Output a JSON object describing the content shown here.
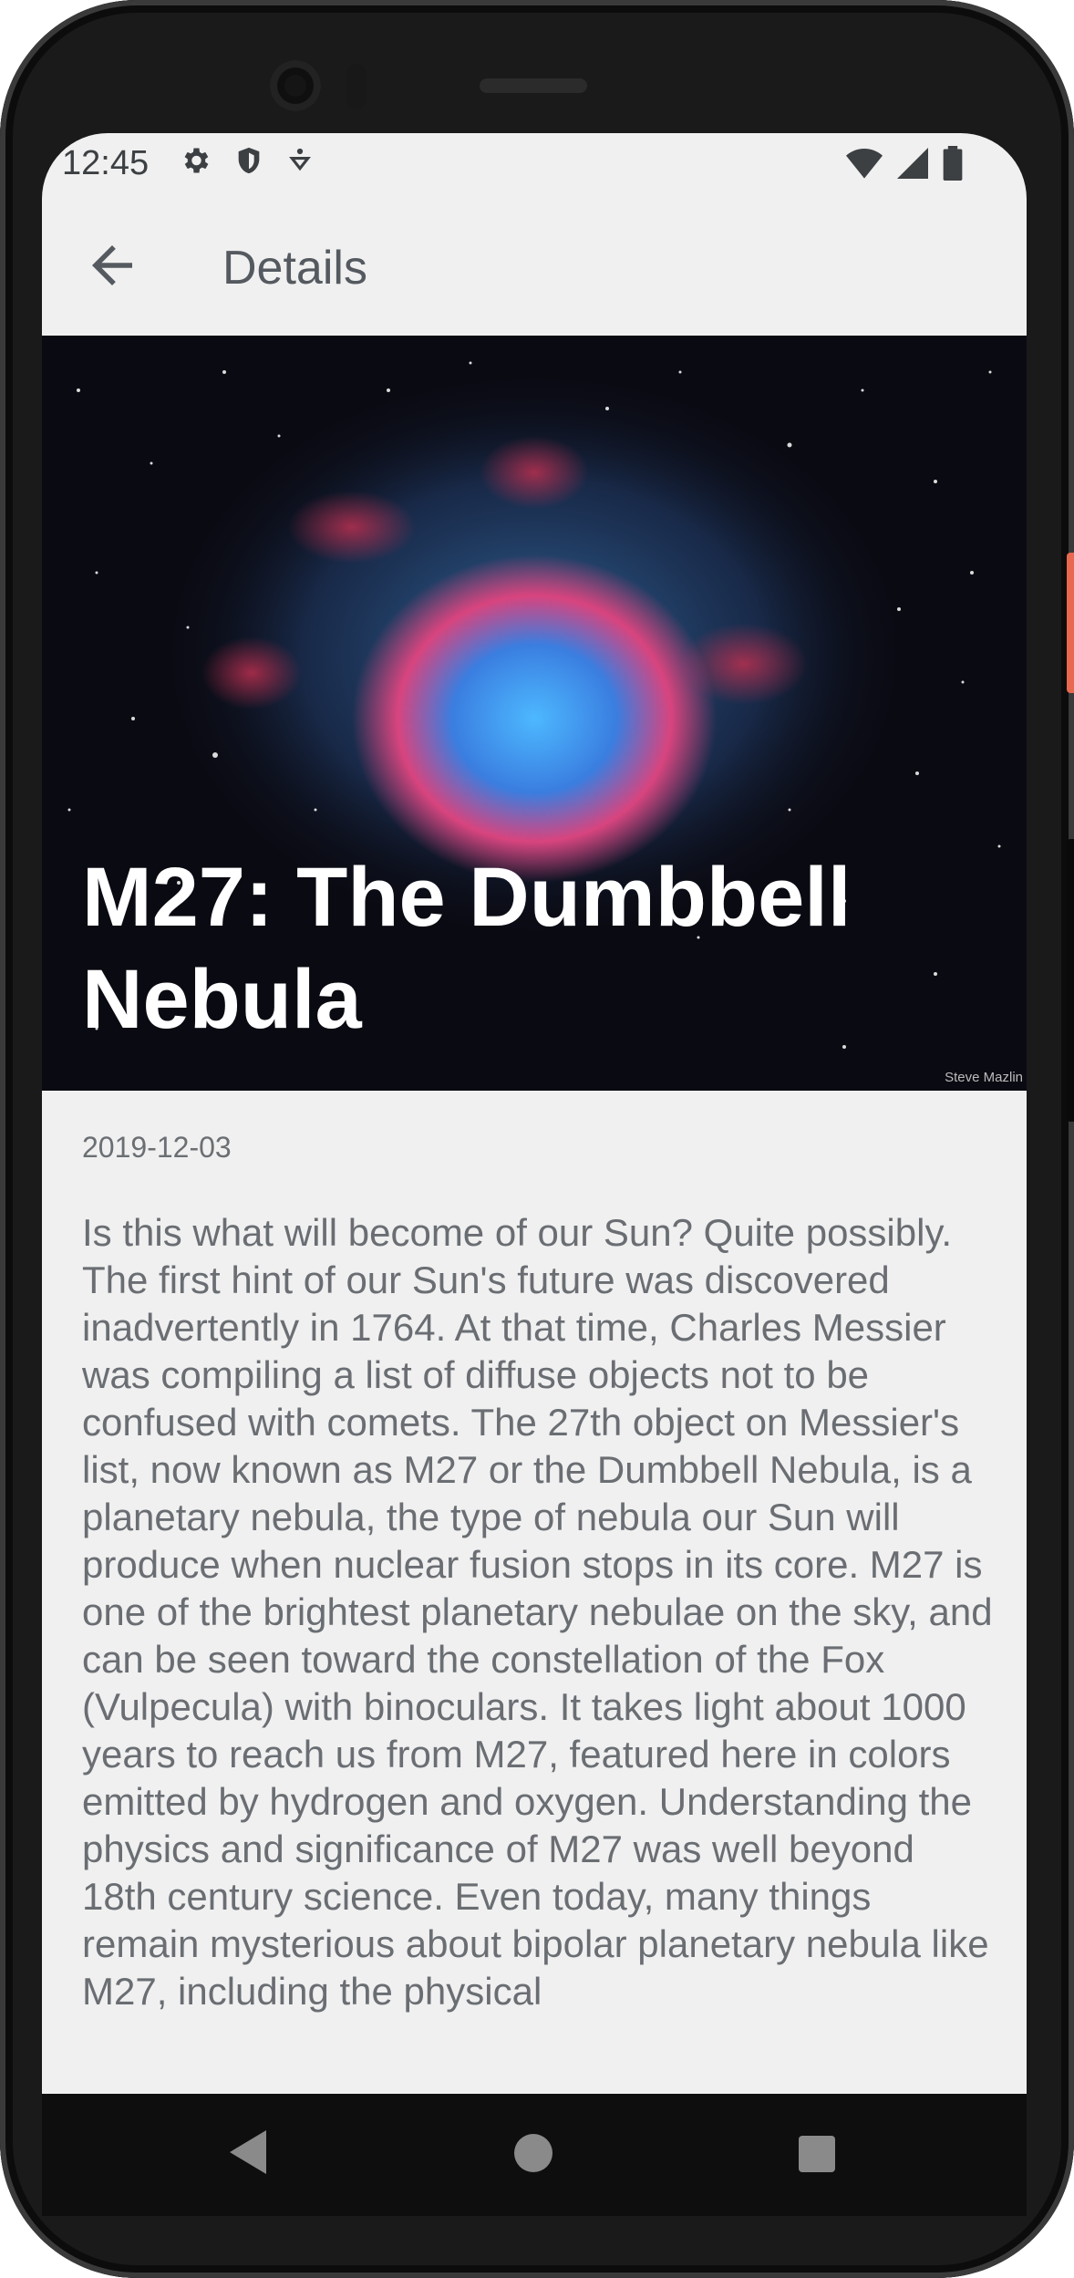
{
  "status_bar": {
    "time": "12:45",
    "left_icons": [
      "gear-icon",
      "shield-icon",
      "accessibility-icon"
    ],
    "right_icons": [
      "wifi-icon",
      "signal-icon",
      "battery-icon"
    ]
  },
  "app_bar": {
    "title": "Details",
    "back_icon": "arrow-left-icon"
  },
  "article": {
    "title": "M27: The Dumbbell Nebula",
    "image_credit": "Steve Mazlin",
    "date": "2019-12-03",
    "body": "Is this what will become of our Sun? Quite possibly.  The first hint of our Sun's future was discovered inadvertently in 1764. At that time, Charles Messier was compiling a list of diffuse objects not to be confused with comets. The 27th object on Messier's list, now known as M27 or the Dumbbell Nebula, is a planetary nebula, the type of nebula our Sun will produce when nuclear fusion stops in its core. M27 is one of the brightest planetary nebulae on the sky, and can be seen toward the constellation of the Fox (Vulpecula) with binoculars. It takes light about 1000 years to reach us from M27, featured here in colors emitted by hydrogen and oxygen. Understanding the physics and significance of M27 was well beyond 18th century science. Even today, many things remain mysterious about bipolar planetary nebula like M27, including the physical"
  },
  "nav_bar": {
    "icons": [
      "back-triangle-icon",
      "home-circle-icon",
      "recents-square-icon"
    ]
  }
}
